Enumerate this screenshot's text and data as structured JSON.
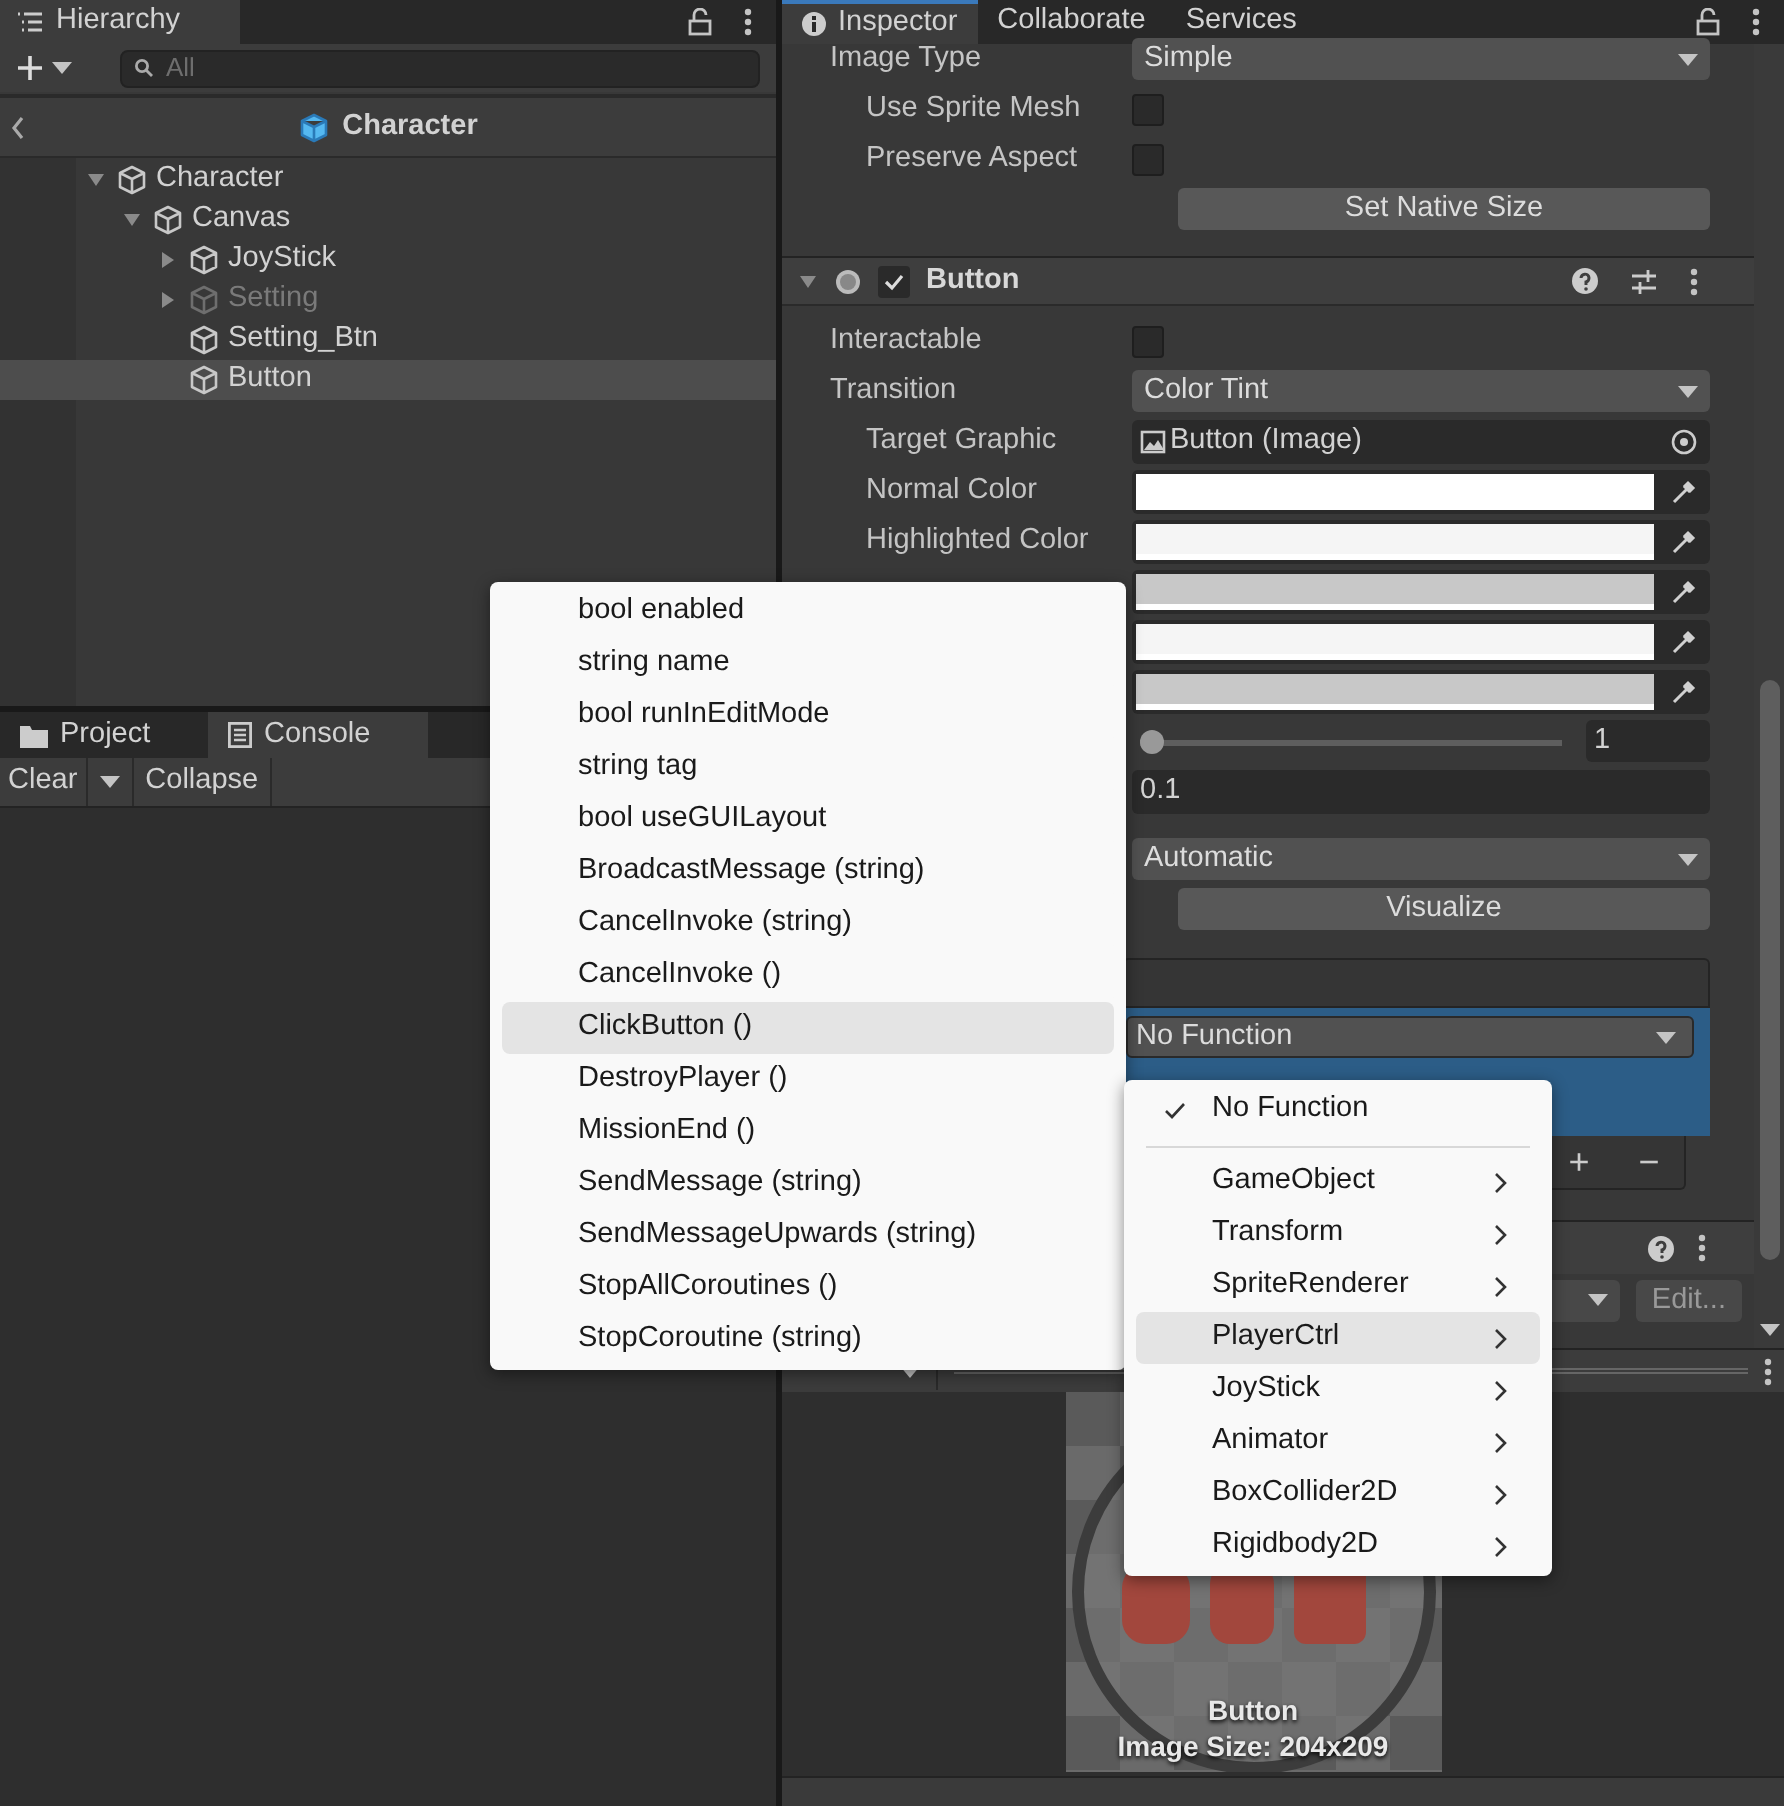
{
  "hierarchy": {
    "tab": "Hierarchy",
    "search": {
      "placeholder": "All"
    },
    "breadcrumb": "Character",
    "tree": [
      {
        "label": "Character",
        "expanded": true,
        "selected": false,
        "disabled": false,
        "children": [
          {
            "label": "Canvas",
            "expanded": true,
            "selected": false,
            "disabled": false,
            "children": [
              {
                "label": "JoyStick",
                "expanded": false,
                "selected": false,
                "disabled": false
              },
              {
                "label": "Setting",
                "expanded": false,
                "selected": false,
                "disabled": true
              },
              {
                "label": "Setting_Btn",
                "selected": false,
                "disabled": false
              },
              {
                "label": "Button",
                "selected": true,
                "disabled": false
              }
            ]
          }
        ]
      }
    ]
  },
  "console_panel": {
    "tabs": [
      {
        "label": "Project",
        "selected": false
      },
      {
        "label": "Console",
        "selected": true
      }
    ],
    "toolbar": [
      "Clear",
      "Collapse"
    ]
  },
  "inspector": {
    "tabs": [
      {
        "label": "Inspector",
        "selected": true
      },
      {
        "label": "Collaborate",
        "selected": false
      },
      {
        "label": "Services",
        "selected": false
      }
    ],
    "image_rows": [
      {
        "kind": "dropdown",
        "label": "Image Type",
        "value": "Simple",
        "children": [
          {
            "kind": "checkbox",
            "label": "Use Sprite Mesh",
            "checked": false
          },
          {
            "kind": "checkbox",
            "label": "Preserve Aspect",
            "checked": false
          }
        ]
      },
      {
        "kind": "button",
        "value": "Set Native Size"
      }
    ],
    "component": {
      "title": "Button",
      "enabled": true,
      "expanded": true
    },
    "rows": [
      {
        "kind": "checkbox",
        "label": "Interactable",
        "checked": false
      },
      {
        "kind": "dropdown",
        "label": "Transition",
        "value": "Color Tint",
        "children": [
          {
            "kind": "object",
            "label": "Target Graphic",
            "value": "Button (Image)"
          },
          {
            "kind": "color",
            "label": "Normal Color",
            "color": "#ffffff"
          },
          {
            "kind": "color",
            "label": "Highlighted Color",
            "color": "#f5f5f5"
          },
          {
            "kind": "color",
            "color": "#c8c8c8"
          },
          {
            "kind": "color",
            "color": "#f5f5f5"
          },
          {
            "kind": "color",
            "color": "#c8c8c8"
          },
          {
            "kind": "slider",
            "level": 0,
            "value": "1"
          },
          {
            "kind": "number",
            "value": "0.1"
          }
        ]
      },
      {
        "kind": "dropdown",
        "value": "Automatic"
      },
      {
        "kind": "button",
        "value": "Visualize"
      }
    ],
    "on_click": {
      "function": "No Function",
      "buttons": [
        "+",
        "−"
      ]
    },
    "next_component": {
      "edit_button": "Edit..."
    },
    "preview": {
      "name": "Button",
      "size": "Image Size: 204x209"
    }
  },
  "method_menu": [
    {
      "label": "bool enabled",
      "highlighted": false
    },
    {
      "label": "string name",
      "highlighted": false
    },
    {
      "label": "bool runInEditMode",
      "highlighted": false
    },
    {
      "label": "string tag",
      "highlighted": false
    },
    {
      "label": "bool useGUILayout",
      "highlighted": false
    },
    {
      "label": "BroadcastMessage (string)",
      "highlighted": false
    },
    {
      "label": "CancelInvoke (string)",
      "highlighted": false
    },
    {
      "label": "CancelInvoke ()",
      "highlighted": false
    },
    {
      "label": "ClickButton ()",
      "highlighted": true
    },
    {
      "label": "DestroyPlayer ()",
      "highlighted": false
    },
    {
      "label": "MissionEnd ()",
      "highlighted": false
    },
    {
      "label": "SendMessage (string)",
      "highlighted": false
    },
    {
      "label": "SendMessageUpwards (string)",
      "highlighted": false
    },
    {
      "label": "StopAllCoroutines ()",
      "highlighted": false
    },
    {
      "label": "StopCoroutine (string)",
      "highlighted": false
    }
  ],
  "component_menu": [
    {
      "kind": "option",
      "label": "No Function",
      "checked": true,
      "highlighted": false
    },
    {
      "kind": "separator"
    },
    {
      "kind": "submenu",
      "label": "GameObject",
      "highlighted": false
    },
    {
      "kind": "submenu",
      "label": "Transform",
      "highlighted": false
    },
    {
      "kind": "submenu",
      "label": "SpriteRenderer",
      "highlighted": false
    },
    {
      "kind": "submenu",
      "label": "PlayerCtrl",
      "highlighted": true
    },
    {
      "kind": "submenu",
      "label": "JoyStick",
      "highlighted": false
    },
    {
      "kind": "submenu",
      "label": "Animator",
      "highlighted": false
    },
    {
      "kind": "submenu",
      "label": "BoxCollider2D",
      "highlighted": false
    },
    {
      "kind": "submenu",
      "label": "Rigidbody2D",
      "highlighted": false
    }
  ]
}
